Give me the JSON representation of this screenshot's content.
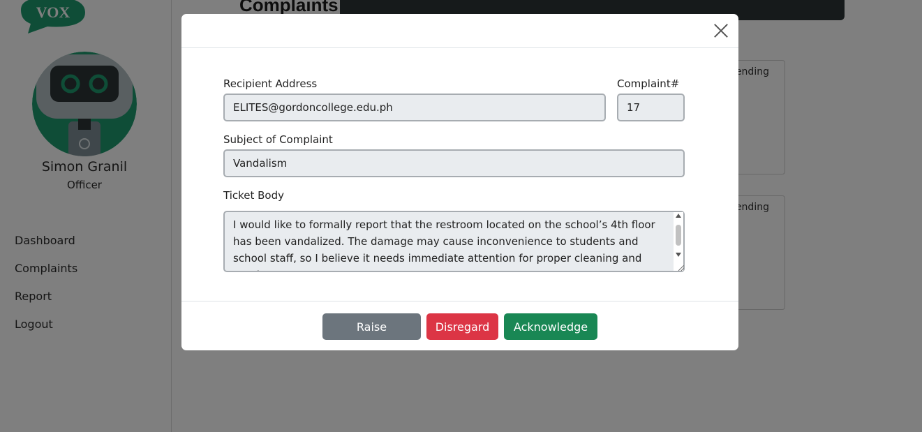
{
  "app": {
    "logo_text": "VOX",
    "user": {
      "name": "Simon Granil",
      "role": "Officer"
    },
    "nav": [
      {
        "label": "Dashboard"
      },
      {
        "label": "Complaints"
      },
      {
        "label": "Report"
      },
      {
        "label": "Logout"
      }
    ],
    "page_title": "Complaints",
    "cards": [
      {
        "status": "Pending"
      },
      {
        "status": "Pending"
      }
    ]
  },
  "modal": {
    "recipient": {
      "label": "Recipient Address",
      "value": "ELITES@gordoncollege.edu.ph"
    },
    "complaint_no": {
      "label": "Complaint#",
      "value": "17"
    },
    "subject": {
      "label": "Subject of Complaint",
      "value": "Vandalism"
    },
    "body": {
      "label": "Ticket Body",
      "value": "I would like to formally report that the restroom located on the school’s 4th floor has been vandalized. The damage may cause inconvenience to students and school staff, so I believe it needs immediate attention for proper cleaning and repair."
    },
    "buttons": {
      "raise": "Raise",
      "disregard": "Disregard",
      "acknowledge": "Acknowledge"
    }
  },
  "colors": {
    "raise": "#6c757d",
    "disregard": "#dc3545",
    "acknowledge": "#198754",
    "logo_green": "#1e9b6f",
    "title_bar": "#2d3436"
  },
  "icons": {
    "close": "close-icon",
    "scroll_up": "chevron-up-icon",
    "scroll_down": "chevron-down-icon",
    "resize": "resize-grip-icon"
  }
}
